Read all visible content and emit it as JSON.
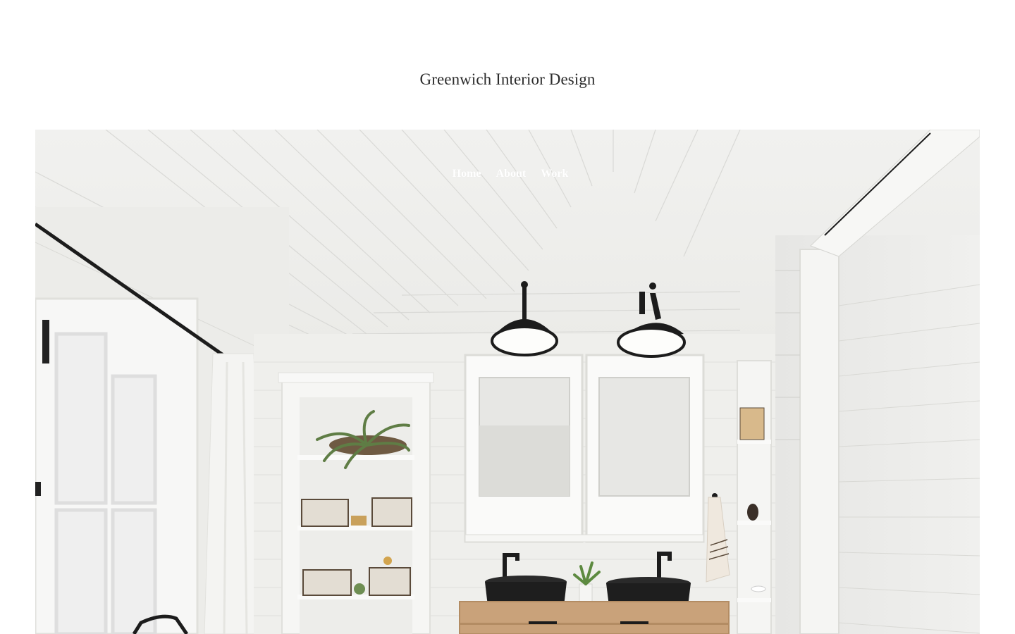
{
  "header": {
    "site_title": "Greenwich Interior Design"
  },
  "nav": {
    "items": [
      {
        "label": "Home"
      },
      {
        "label": "About"
      },
      {
        "label": "Work"
      }
    ]
  },
  "hero": {
    "image_subject": "white shiplap bathroom with double black vessel sinks and black barn sconces"
  },
  "colors": {
    "background": "#ffffff",
    "title_text": "#2b2b2b",
    "nav_text": "#ffffff",
    "fixture_black": "#1c1c1c",
    "wood": "#c9a27a"
  }
}
